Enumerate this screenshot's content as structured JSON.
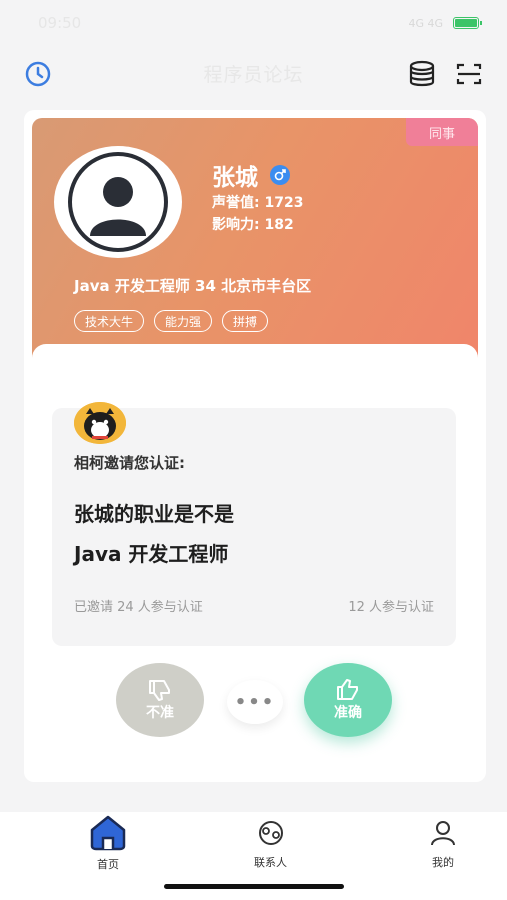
{
  "status_bar": {
    "time": "09:50",
    "network": "4G 4G"
  },
  "nav": {
    "title": "程序员论坛",
    "left_icon": "clock-icon",
    "right_icons": [
      "database-icon",
      "scan-icon"
    ]
  },
  "profile": {
    "relation_tag": "同事",
    "name": "张城",
    "gender_icon": "male-icon",
    "reputation": "声誉值: 1723",
    "influence": "影响力: 182",
    "job_line": "Java 开发工程师 34 北京市丰台区",
    "tags": [
      "技术大牛",
      "能力强",
      "拼搏"
    ]
  },
  "invitation": {
    "invite_text": "相柯邀请您认证:",
    "question_line1": "张城的职业是不是",
    "question_line2": "Java 开发工程师",
    "invited_count": "已邀请 24 人参与认证",
    "participated_count": "12 人参与认证"
  },
  "actions": {
    "disagree_label": "不准",
    "more_label": "•••",
    "agree_label": "准确"
  },
  "tabs": [
    {
      "label": "首页",
      "icon": "home-icon",
      "active": true
    },
    {
      "label": "联系人",
      "icon": "contacts-icon",
      "active": false
    },
    {
      "label": "我的",
      "icon": "user-icon",
      "active": false
    }
  ],
  "colors": {
    "accent_blue": "#3c7de0",
    "agree_green": "#6fd8b4",
    "disagree_gray": "#cfcfc8",
    "tag_pink": "#f07f98",
    "profile_gradient_start": "#d89a74",
    "profile_gradient_end": "#f0856a"
  }
}
